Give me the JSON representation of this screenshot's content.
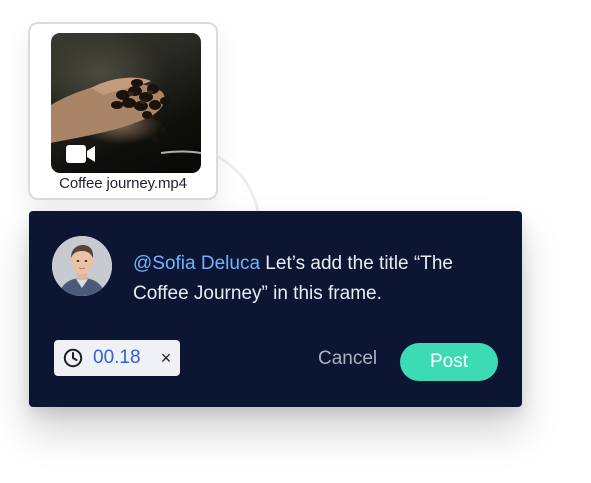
{
  "file_card": {
    "file_name": "Coffee journey.mp4",
    "video_icon": "video-camera-icon"
  },
  "comment": {
    "mention": "@Sofia Deluca",
    "message": " Let’s add the title “The Coffee Journey” in this frame.",
    "avatar": "user-avatar"
  },
  "timestamp": {
    "value": "00.18",
    "icon": "clock-icon",
    "remove_glyph": "×"
  },
  "actions": {
    "cancel_label": "Cancel",
    "post_label": "Post"
  },
  "colors": {
    "panel_background": "#0c1633",
    "mention": "#6fb3ff",
    "post_button": "#3ddbb3",
    "timestamp_text": "#2f62d6"
  }
}
